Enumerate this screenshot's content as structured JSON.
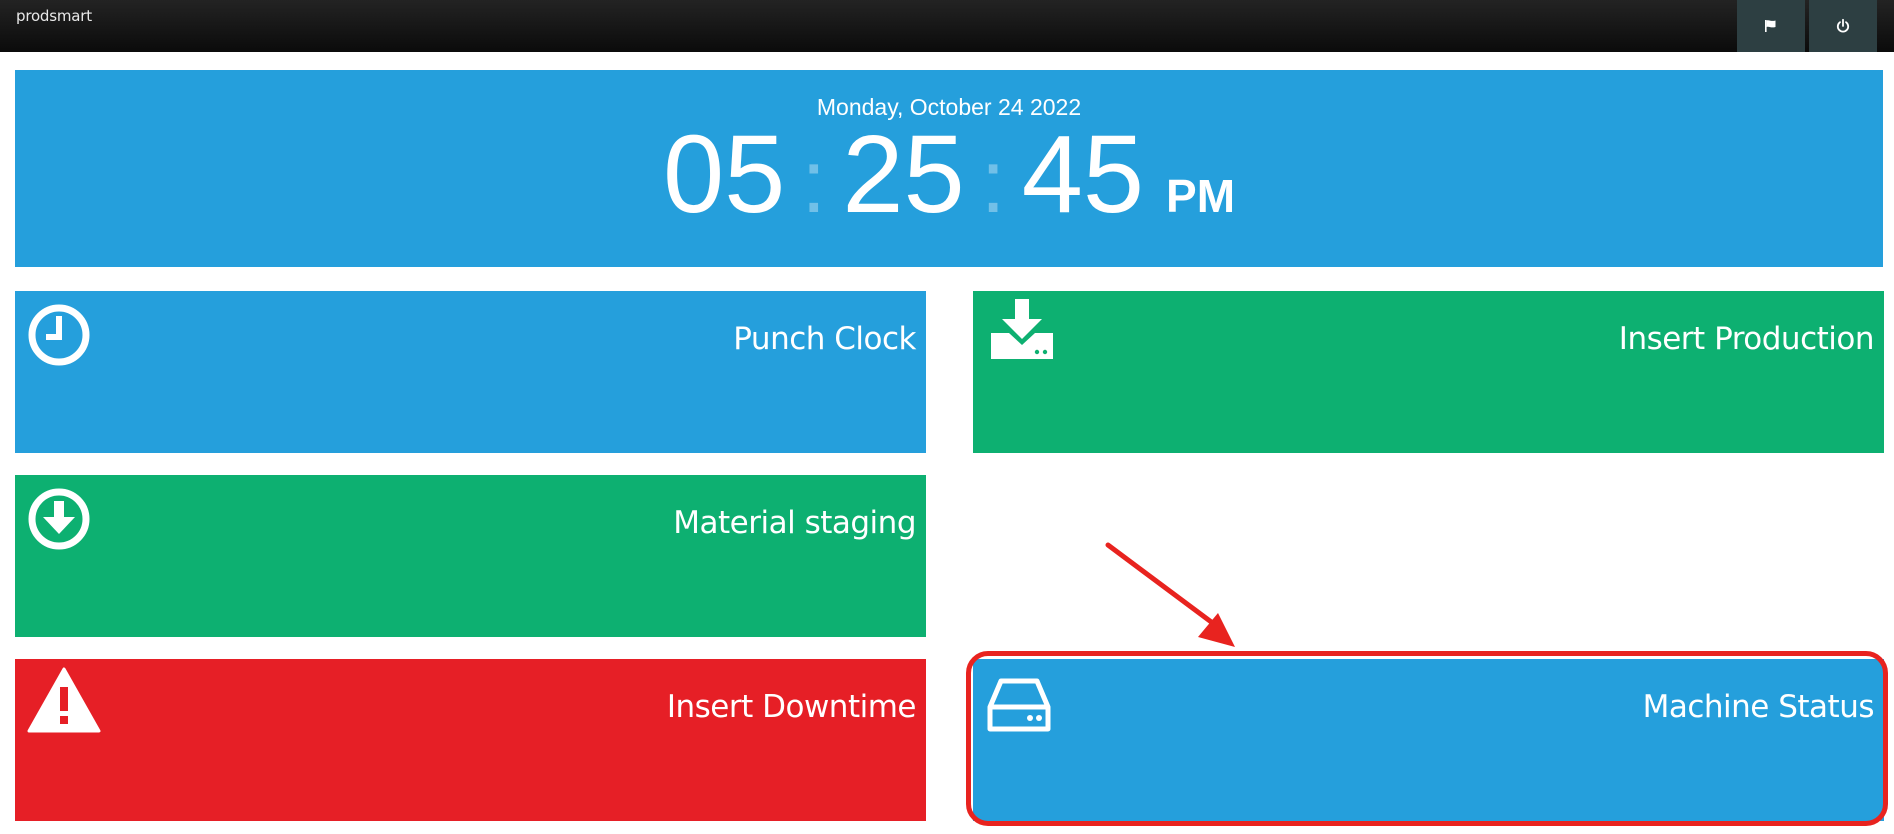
{
  "app": {
    "brand": "prodsmart",
    "top_buttons": [
      {
        "icon": "flag-icon"
      },
      {
        "icon": "power-icon"
      }
    ]
  },
  "clock": {
    "date": "Monday, October 24 2022",
    "hours": "05",
    "minutes": "25",
    "seconds": "45",
    "separator": ":",
    "ampm": "PM"
  },
  "tiles": [
    {
      "label": "Punch Clock",
      "icon": "clock-icon",
      "color": "#259fdc"
    },
    {
      "label": "Insert Production",
      "icon": "download-tray-icon",
      "color": "#0db071"
    },
    {
      "label": "Material staging",
      "icon": "circle-arrow-down-icon",
      "color": "#0db071"
    },
    {
      "label": "Insert Downtime",
      "icon": "warning-icon",
      "color": "#e61f26"
    },
    {
      "label": "Machine Status",
      "icon": "hard-drive-icon",
      "color": "#259fdc"
    }
  ],
  "annotation": {
    "color": "#e8231f",
    "highlighted_tile": "Machine Status"
  }
}
